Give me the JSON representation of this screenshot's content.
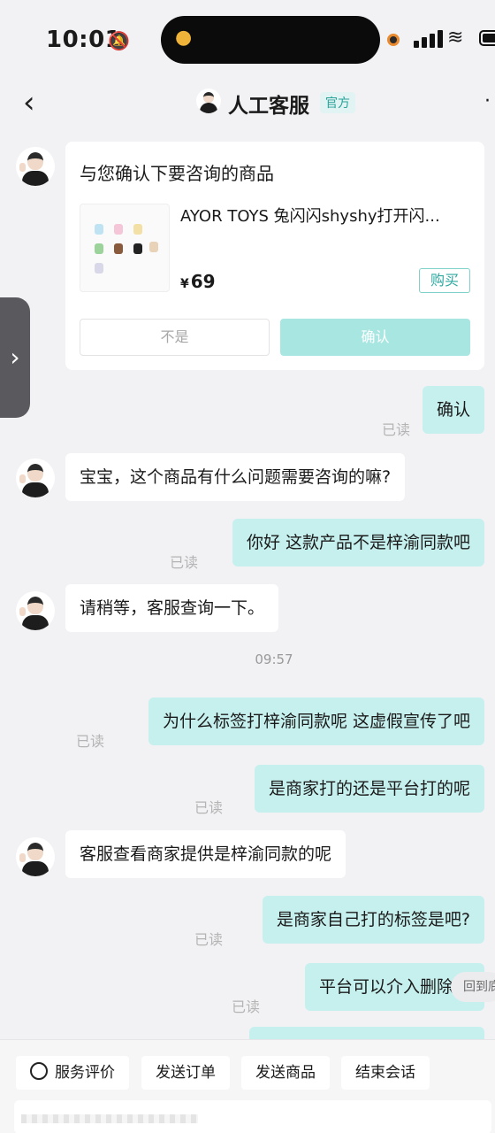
{
  "status_bar": {
    "time": "10:01"
  },
  "nav": {
    "title": "人工客服",
    "badge": "官方"
  },
  "product_card": {
    "prompt": "与您确认下要咨询的商品",
    "product_name": "AYOR TOYS 兔闪闪shyshy打开闪...",
    "price_symbol": "¥",
    "price": "69",
    "buy_label": "购买",
    "no_label": "不是",
    "confirm_label": "确认"
  },
  "messages": [
    {
      "side": "right",
      "text": "确认",
      "status": "已读"
    },
    {
      "side": "left",
      "text": "宝宝，这个商品有什么问题需要咨询的嘛?"
    },
    {
      "side": "right",
      "text": "你好 这款产品不是梓渝同款吧",
      "status": "已读"
    },
    {
      "side": "left",
      "text": "请稍等，客服查询一下。"
    },
    {
      "side": "right",
      "text": "为什么标签打梓渝同款呢 这虚假宣传了吧",
      "status": "已读"
    },
    {
      "side": "right",
      "text": "是商家打的还是平台打的呢",
      "status": "已读"
    },
    {
      "side": "left",
      "text": "客服查看商家提供是梓渝同款的呢"
    },
    {
      "side": "right",
      "text": "是商家自己打的标签是吧?",
      "status": "已读"
    },
    {
      "side": "right",
      "text": "平台可以介入删除吗",
      "status": "已读"
    }
  ],
  "timestamp": "09:57",
  "recall_label": "回到底",
  "quick_actions": [
    "服务评价",
    "发送订单",
    "发送商品",
    "结束会话"
  ],
  "icons": {
    "back": "chevron-left-icon",
    "feedback": "smile-icon",
    "side_handle": "chevron-right-icon"
  }
}
